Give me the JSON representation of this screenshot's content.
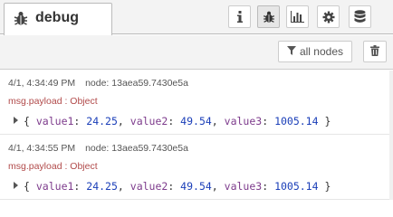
{
  "tab": {
    "label": "debug",
    "icon": "bug-icon"
  },
  "header_buttons": [
    {
      "icon": "info-icon"
    },
    {
      "icon": "bug-icon",
      "active": true
    },
    {
      "icon": "bar-chart-icon"
    },
    {
      "icon": "gear-icon"
    },
    {
      "icon": "database-icon"
    }
  ],
  "toolbar": {
    "filter_label": "all nodes",
    "filter_icon": "filter-icon",
    "clear_icon": "trash-icon"
  },
  "messages": [
    {
      "timestamp": "4/1, 4:34:49 PM",
      "node_label": "node:",
      "node_id": "13aea59.7430e5a",
      "topic": "msg.payload : Object",
      "payload": {
        "open": "{",
        "k1": "value1",
        "v1": "24.25",
        "k2": "value2",
        "v2": "49.54",
        "k3": "value3",
        "v3": "1005.14",
        "close": "}"
      }
    },
    {
      "timestamp": "4/1, 4:34:55 PM",
      "node_label": "node:",
      "node_id": "13aea59.7430e5a",
      "topic": "msg.payload : Object",
      "payload": {
        "open": "{",
        "k1": "value1",
        "v1": "24.25",
        "k2": "value2",
        "v2": "49.54",
        "k3": "value3",
        "v3": "1005.14",
        "close": "}"
      }
    }
  ],
  "colors": {
    "topic": "#b14a4a",
    "key": "#7d3b8c",
    "number": "#1a3eb8"
  }
}
